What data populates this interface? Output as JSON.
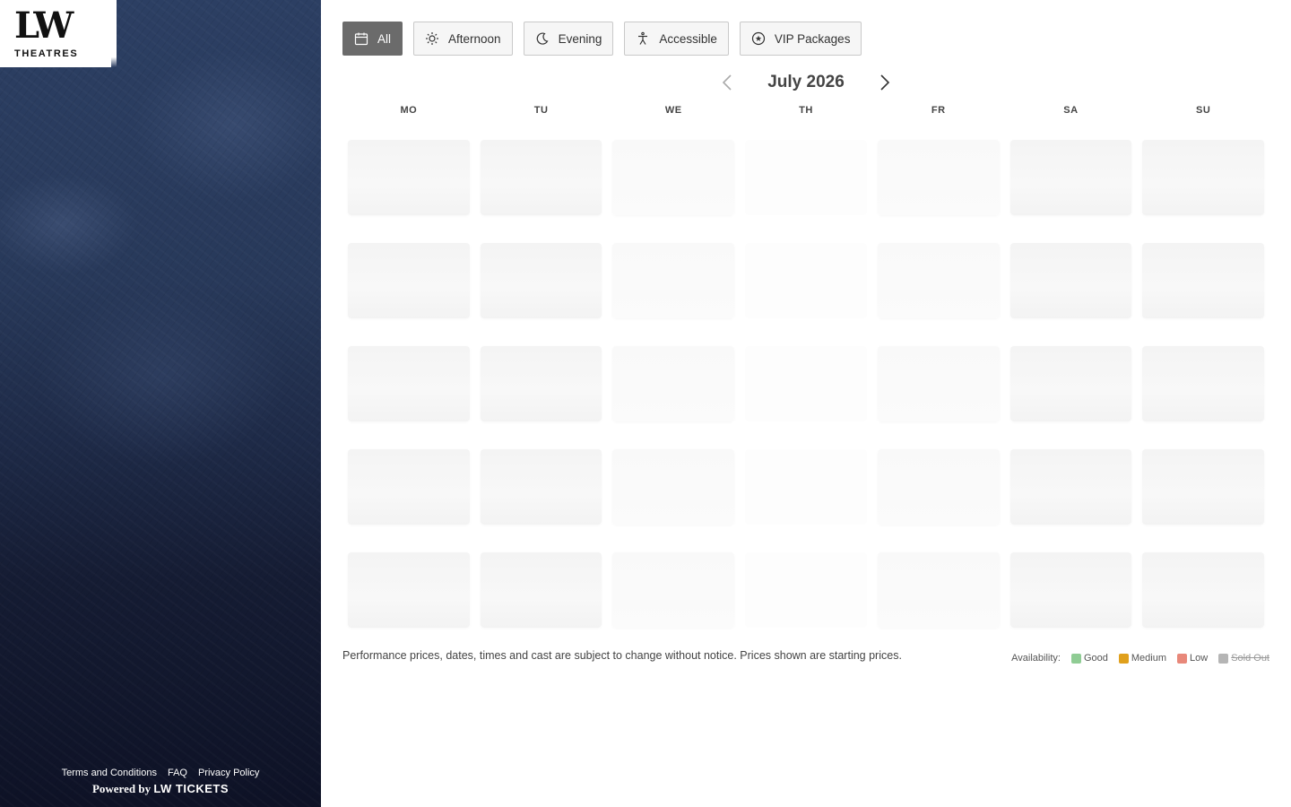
{
  "brand": {
    "logo_mark": "LW",
    "logo_sub": "THEATRES"
  },
  "footer": {
    "links": [
      "Terms and Conditions",
      "FAQ",
      "Privacy Policy"
    ],
    "powered_prefix": "Powered by",
    "powered_brand": "LW TICKETS"
  },
  "filters": [
    {
      "label": "All",
      "icon": "calendar-icon",
      "active": true
    },
    {
      "label": "Afternoon",
      "icon": "sun-icon",
      "active": false
    },
    {
      "label": "Evening",
      "icon": "moon-icon",
      "active": false
    },
    {
      "label": "Accessible",
      "icon": "accessible-icon",
      "active": false
    },
    {
      "label": "VIP Packages",
      "icon": "star-icon",
      "active": false
    }
  ],
  "calendar": {
    "month": "July 2026",
    "weekdays": [
      "MO",
      "TU",
      "WE",
      "TH",
      "FR",
      "SA",
      "SU"
    ]
  },
  "disclaimer": "Performance prices, dates, times and cast are subject to change without notice. Prices shown are starting prices.",
  "legend": {
    "label": "Availability:",
    "items": [
      {
        "label": "Good",
        "color": "#8fcc94"
      },
      {
        "label": "Medium",
        "color": "#e0a01c"
      },
      {
        "label": "Low",
        "color": "#e8887a"
      },
      {
        "label": "Sold Out",
        "color": "#b5b5b5"
      }
    ]
  },
  "colors": {
    "active_filter": "#6b6b6b",
    "sidebar_top": "#2c3f63",
    "sidebar_bottom": "#0e1226"
  }
}
